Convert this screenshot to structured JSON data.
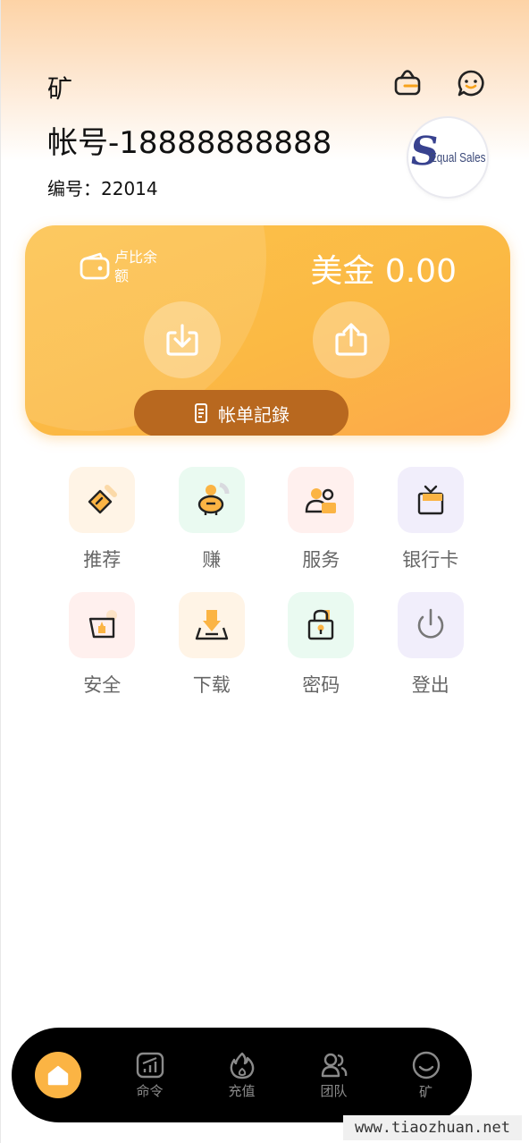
{
  "header": {
    "title": "矿",
    "account_title": "帐号-18888888888",
    "account_number": "编号：22014",
    "icons": [
      "wallet-lock-icon",
      "chat-smile-icon"
    ]
  },
  "logo": {
    "letter": "S",
    "text": "Equal Sales"
  },
  "balance_card": {
    "label": "卢比余额",
    "value": "美金 0.00",
    "deposit_icon": "download-icon",
    "withdraw_icon": "upload-icon",
    "history_label": "帐单記錄",
    "colors": {
      "card_start": "#fcc24a",
      "card_end": "#fca84a",
      "history_button": "#b8681f"
    }
  },
  "menu": {
    "items": [
      {
        "label": "推荐",
        "icon": "recommend-icon",
        "bg": "#fff4e6"
      },
      {
        "label": "赚",
        "icon": "earn-piggy-icon",
        "bg": "#eafaf1"
      },
      {
        "label": "服务",
        "icon": "service-people-icon",
        "bg": "#fff0ee"
      },
      {
        "label": "银行卡",
        "icon": "bank-card-icon",
        "bg": "#f1eefb"
      },
      {
        "label": "安全",
        "icon": "security-icon",
        "bg": "#fff0ee"
      },
      {
        "label": "下载",
        "icon": "download-tray-icon",
        "bg": "#fff4e6"
      },
      {
        "label": "密码",
        "icon": "password-lock-icon",
        "bg": "#eafaf1"
      },
      {
        "label": "登出",
        "icon": "power-icon",
        "bg": "#f1eefb"
      }
    ]
  },
  "bottom_nav": {
    "items": [
      {
        "label": "",
        "icon": "home-icon",
        "active": true
      },
      {
        "label": "命令",
        "icon": "orders-chart-icon"
      },
      {
        "label": "充值",
        "icon": "flame-icon"
      },
      {
        "label": "团队",
        "icon": "team-icon"
      },
      {
        "label": "矿",
        "icon": "mine-smile-icon"
      }
    ],
    "accent": "#fbb444"
  },
  "watermark": "www.tiaozhuan.net"
}
